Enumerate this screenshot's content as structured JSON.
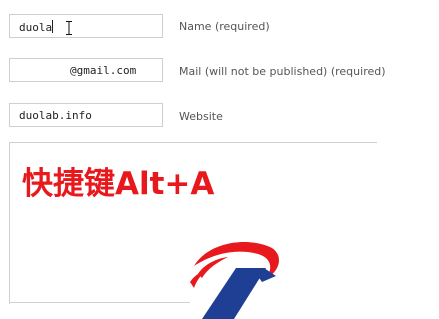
{
  "form": {
    "name": {
      "value": "duola",
      "label": "Name (required)"
    },
    "mail": {
      "value": "@gmail.com",
      "label": "Mail (will not be published) (required)"
    },
    "website": {
      "value": "duolab.info",
      "label": "Website"
    }
  },
  "overlay": {
    "shortcut_text": "快捷键Alt+A",
    "logo_name": "duolab-logo",
    "colors": {
      "text": "#e8191d",
      "logo_red": "#e8191d",
      "logo_blue": "#1e3f93"
    }
  },
  "icons": {
    "cursor": "text-cursor-icon"
  }
}
